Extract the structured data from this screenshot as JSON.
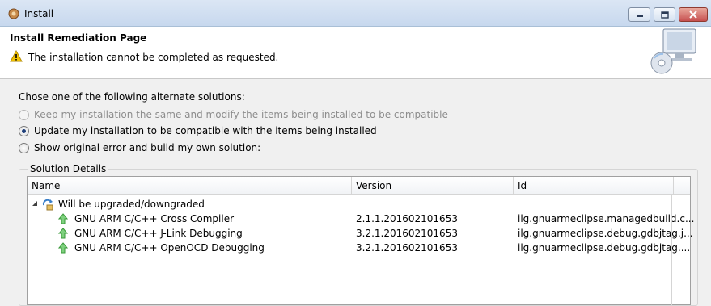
{
  "window": {
    "title": "Install"
  },
  "header": {
    "page_title": "Install Remediation Page",
    "message": "The installation cannot be completed as requested."
  },
  "options": {
    "instruction": "Chose one of the following alternate solutions:",
    "items": [
      {
        "label": "Keep my installation the same and modify the items being installed to be compatible",
        "state": "disabled"
      },
      {
        "label": "Update my installation to be compatible with the items being installed",
        "state": "selected"
      },
      {
        "label": "Show original error and build my own solution:",
        "state": "unselected"
      }
    ]
  },
  "details": {
    "group_label": "Solution Details",
    "columns": [
      "Name",
      "Version",
      "Id"
    ],
    "category": "Will be upgraded/downgraded",
    "rows": [
      {
        "name": "GNU ARM C/C++ Cross Compiler",
        "version": "2.1.1.201602101653",
        "id": "ilg.gnuarmeclipse.managedbuild.c..."
      },
      {
        "name": "GNU ARM C/C++ J-Link Debugging",
        "version": "3.2.1.201602101653",
        "id": "ilg.gnuarmeclipse.debug.gdbjtag.j..."
      },
      {
        "name": "GNU ARM C/C++ OpenOCD Debugging",
        "version": "3.2.1.201602101653",
        "id": "ilg.gnuarmeclipse.debug.gdbjtag...."
      }
    ]
  },
  "colors": {
    "accent": "#1f3f7a",
    "upgrade_arrow": "#3a9a3a",
    "warning": "#f2c200"
  },
  "icons": [
    "app-icon",
    "minimize-icon",
    "maximize-icon",
    "close-icon",
    "warning-icon",
    "install-banner-icon",
    "expander-icon",
    "update-group-icon",
    "upgrade-arrow-icon"
  ]
}
